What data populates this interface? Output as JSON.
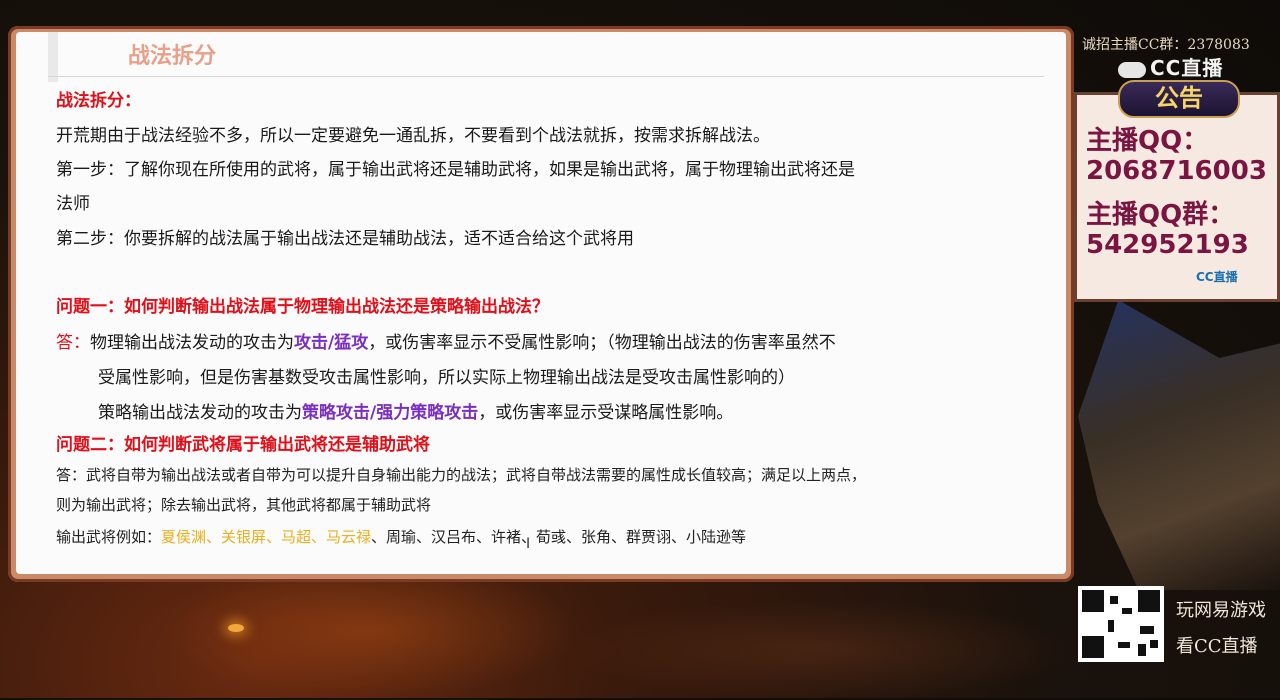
{
  "slide": {
    "title": "战法拆分",
    "heading": "战法拆分：",
    "intro": "开荒期由于战法经验不多，所以一定要避免一通乱拆，不要看到个战法就拆，按需求拆解战法。",
    "step1_a": "第一步：了解你现在所使用的武将，属于输出武将还是辅助武将，如果是输出武将，属于物理输出武将还是",
    "step1_b": "法师",
    "step2": "第二步：你要拆解的战法属于输出战法还是辅助战法，适不适合给这个武将用",
    "q1": "问题一：如何判断输出战法属于物理输出战法还是策略输出战法？",
    "a1_label": "答：",
    "a1_l1_pre": "物理输出战法发动的攻击为",
    "a1_l1_em": "攻击/猛攻",
    "a1_l1_post": "，或伤害率显示不受属性影响；（物理输出战法的伤害率虽然不",
    "a1_l2": "受属性影响，但是伤害基数受攻击属性影响，所以实际上物理输出战法是受攻击属性影响的）",
    "a1_l3_pre": "策略输出战法发动的攻击为",
    "a1_l3_em": "策略攻击/强力策略攻击",
    "a1_l3_post": "，或伤害率显示受谋略属性影响。",
    "q2": "问题二：如何判断武将属于输出武将还是辅助武将",
    "a2_l1": "答：武将自带为输出战法或者自带为可以提升自身输出能力的战法；武将自带战法需要的属性成长值较高；满足以上两点，",
    "a2_l2": "则为输出武将；除去输出武将，其他武将都属于辅助武将",
    "examples_label": "输出武将例如：",
    "examples_highlight": "夏侯渊、关银屏、马超、马云禄",
    "examples_rest": "、周瑜、汉吕布、许褚、荀彧、张角、群贾诩、小陆逊等",
    "cursor": "I"
  },
  "side": {
    "recruit": "诚招主播CC群：2378083",
    "cc_logo": "CC直播",
    "notice_badge": "公告",
    "qq_label": "主播QQ：",
    "qq_value": "2068716003",
    "group_label": "主播QQ群：",
    "group_value": "542952193",
    "cc_small": "CC直播",
    "promo1": "玩网易游戏",
    "promo2": "看CC直播"
  }
}
